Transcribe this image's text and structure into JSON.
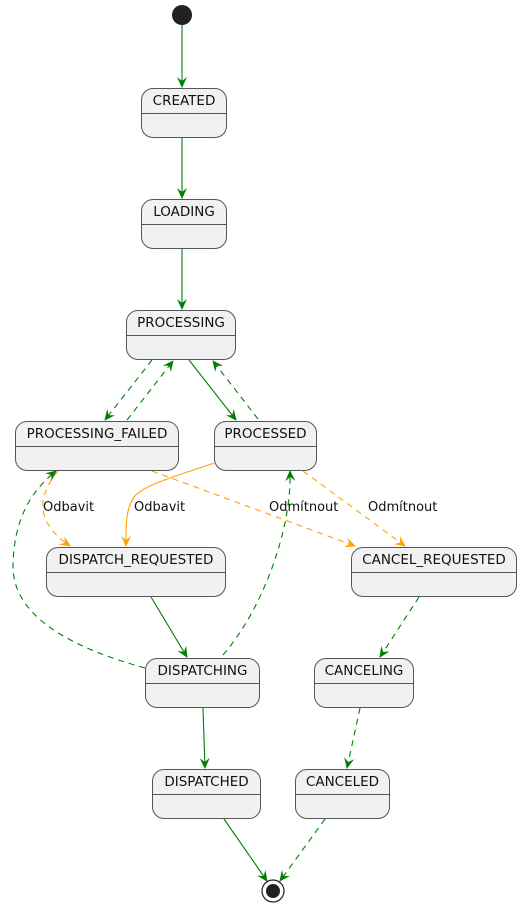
{
  "diagram": {
    "states": {
      "created": "CREATED",
      "loading": "LOADING",
      "processing": "PROCESSING",
      "processing_failed": "PROCESSING_FAILED",
      "processed": "PROCESSED",
      "dispatch_requested": "DISPATCH_REQUESTED",
      "cancel_requested": "CANCEL_REQUESTED",
      "dispatching": "DISPATCHING",
      "canceling": "CANCELING",
      "dispatched": "DISPATCHED",
      "canceled": "CANCELED"
    },
    "transition_labels": {
      "failed_dispatch": "Odbavit",
      "processed_dispatch": "Odbavit",
      "failed_cancel": "Odmítnout",
      "processed_cancel": "Odmítnout"
    },
    "colors": {
      "normal": "#008000",
      "user_action": "#FFA500",
      "state_fill": "#F1F1F1",
      "state_border": "#555555"
    }
  }
}
